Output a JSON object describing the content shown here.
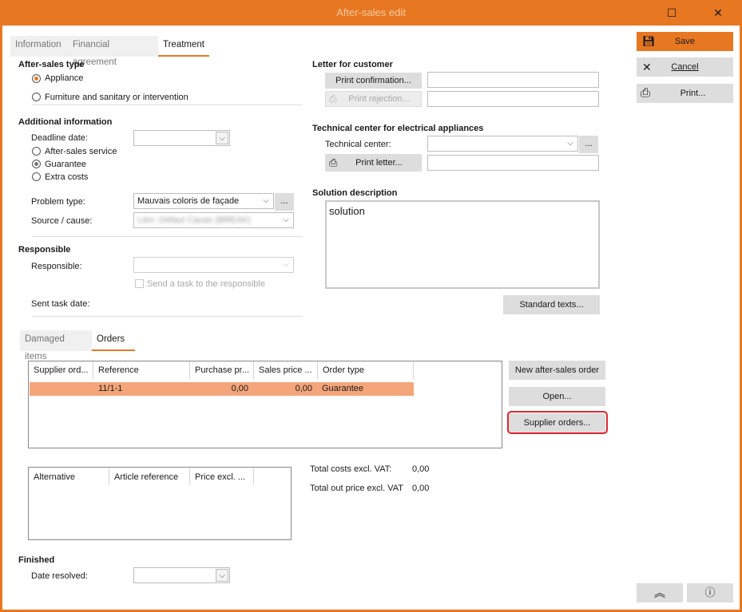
{
  "window": {
    "title": "After-sales edit"
  },
  "tabs": [
    "Information",
    "Financial agreement",
    "Treatment"
  ],
  "after_sales_type": {
    "heading": "After-sales type",
    "options": [
      "Appliance",
      "Furniture and sanitary or intervention"
    ]
  },
  "additional": {
    "heading": "Additional information",
    "deadline_label": "Deadline date:",
    "options": [
      "After-sales service",
      "Guarantee",
      "Extra costs"
    ],
    "problem_label": "Problem type:",
    "problem_value": "Mauvais coloris de façade",
    "source_label": "Source / cause:",
    "source_value": "Lien: Défaut Cause (BREAK)"
  },
  "responsible": {
    "heading": "Responsible",
    "label": "Responsible:",
    "send_task": "Send a task to the responsible",
    "sent_label": "Sent task date:"
  },
  "letter": {
    "heading": "Letter for customer",
    "print_confirmation": "Print confirmation...",
    "print_rejection": "Print rejection..."
  },
  "technical": {
    "heading": "Technical center for electrical appliances",
    "center_label": "Technical center:",
    "print_letter": "Print letter..."
  },
  "solution": {
    "heading": "Solution description",
    "text": "solution",
    "standard_texts": "Standard texts..."
  },
  "lower_tabs": [
    "Damaged items",
    "Orders"
  ],
  "orders": {
    "columns": [
      "Supplier ord...",
      "Reference",
      "Purchase pr...",
      "Sales price ...",
      "Order type"
    ],
    "rows": [
      [
        "",
        "11/1-1",
        "0,00",
        "0,00",
        "Guarantee"
      ]
    ]
  },
  "order_buttons": [
    "New after-sales order",
    "Open...",
    "Supplier orders..."
  ],
  "alternatives": {
    "columns": [
      "Alternative",
      "Article reference",
      "Price excl. ..."
    ]
  },
  "totals": {
    "costs_label": "Total costs excl. VAT:",
    "costs_value": "0,00",
    "out_label": "Total out price excl. VAT",
    "out_value": "0,00"
  },
  "finished": {
    "heading": "Finished",
    "date_label": "Date resolved:"
  },
  "side": {
    "save": "Save",
    "cancel": "Cancel",
    "print": "Print..."
  },
  "colors": {
    "accent": "#e87722",
    "row_highlight": "#f4a57a",
    "callout": "#e0262e"
  }
}
